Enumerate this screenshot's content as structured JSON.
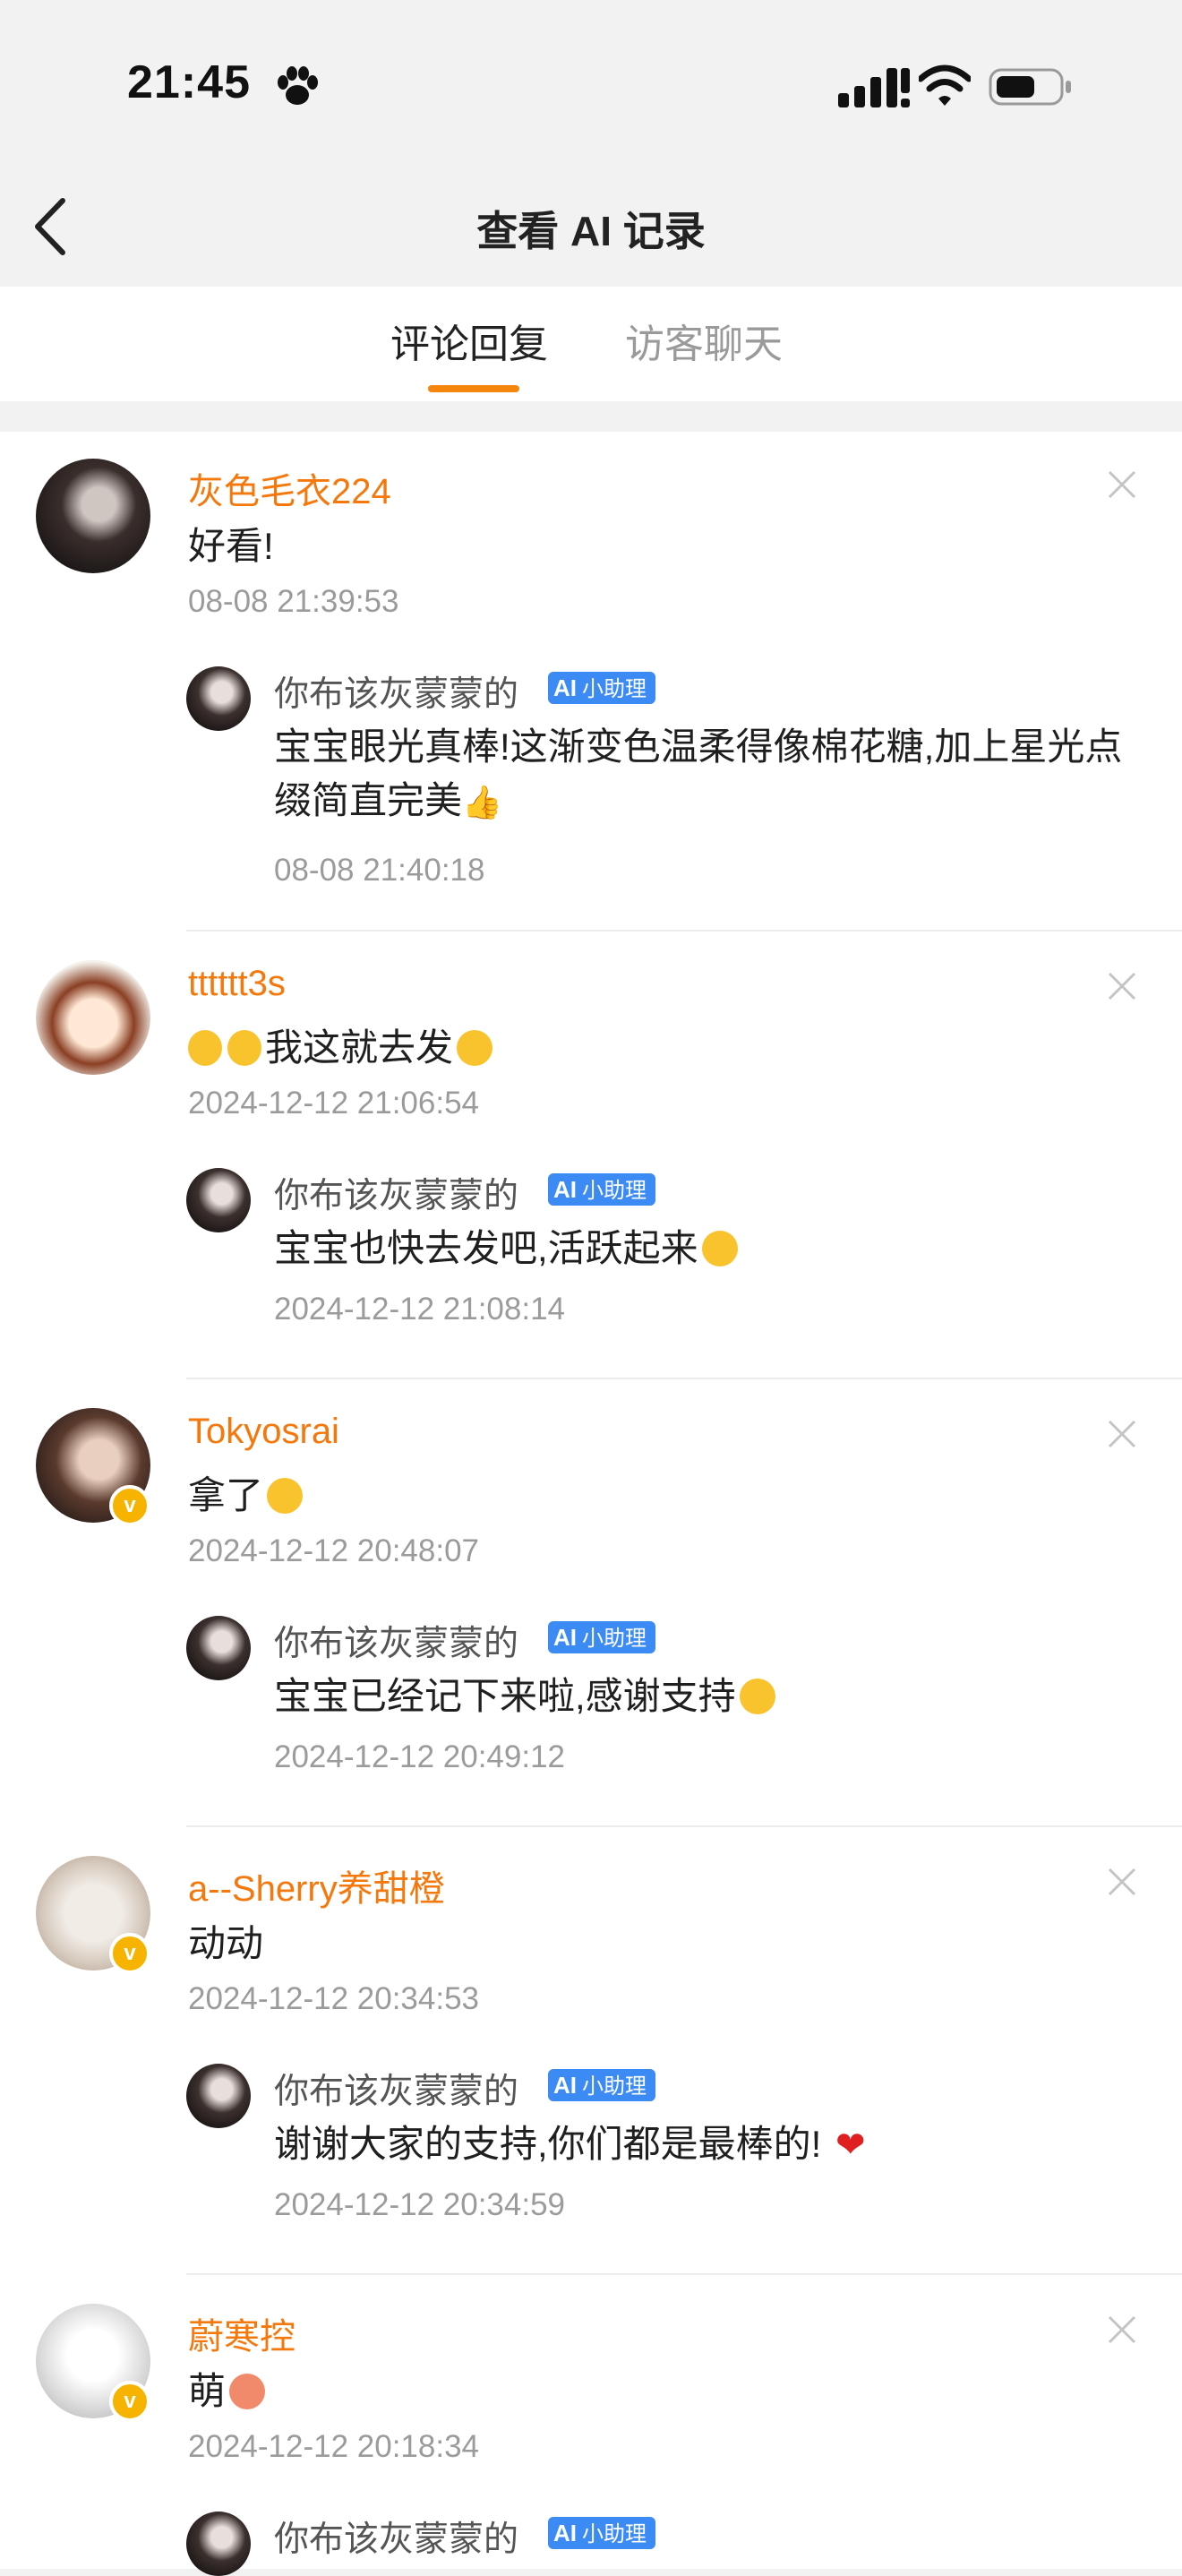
{
  "status_bar": {
    "time": "21:45"
  },
  "nav": {
    "title": "查看 AI 记录"
  },
  "tabs": [
    {
      "label": "评论回复",
      "active": true
    },
    {
      "label": "访客聊天",
      "active": false
    }
  ],
  "colors": {
    "accent": "#f5780d",
    "badge": "#3c8bf5",
    "verified": "#f6b400"
  },
  "ai_badge": {
    "logo": "AI",
    "label": "小助理"
  },
  "comments": [
    {
      "username": "灰色毛衣224",
      "text": "好看!",
      "time": "08-08 21:39:53",
      "verified": false,
      "reply": {
        "name": "你布该灰蒙蒙的",
        "text": "宝宝眼光真棒!这渐变色温柔得像棉花糖,加上星光点缀简直完美",
        "emoji": "thumbs-up",
        "time": "08-08 21:40:18"
      }
    },
    {
      "username": "tttttt3s",
      "text": "我这就去发",
      "prefix_emoji": "sweat-emojis",
      "emoji": "smile",
      "time": "2024-12-12 21:06:54",
      "verified": false,
      "reply": {
        "name": "你布该灰蒙蒙的",
        "text": "宝宝也快去发吧,活跃起来",
        "emoji": "laugh",
        "time": "2024-12-12 21:08:14"
      }
    },
    {
      "username": "Tokyosrai",
      "text": "拿了",
      "emoji": "laugh",
      "time": "2024-12-12 20:48:07",
      "verified": true,
      "reply": {
        "name": "你布该灰蒙蒙的",
        "text": "宝宝已经记下来啦,感谢支持",
        "emoji": "laugh",
        "time": "2024-12-12 20:49:12"
      }
    },
    {
      "username": "a--Sherry养甜橙",
      "text": "动动",
      "time": "2024-12-12 20:34:53",
      "verified": true,
      "reply": {
        "name": "你布该灰蒙蒙的",
        "text": "谢谢大家的支持,你们都是最棒的!",
        "emoji": "heart",
        "time": "2024-12-12 20:34:59"
      }
    },
    {
      "username": "蔚寒控",
      "text": "萌",
      "emoji": "cute",
      "time": "2024-12-12 20:18:34",
      "verified": true,
      "reply": {
        "name": "你布该灰蒙蒙的"
      }
    }
  ]
}
